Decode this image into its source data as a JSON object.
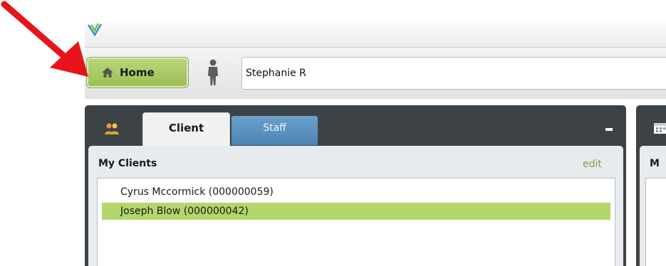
{
  "nav": {
    "home_label": "Home",
    "home_icon": "house-icon",
    "user_icon": "person-icon",
    "current_user": "Stephanie R"
  },
  "panel": {
    "tabs": [
      {
        "label": "Client",
        "active": true
      },
      {
        "label": "Staff",
        "active": false
      }
    ],
    "collapse_label": "-",
    "section_title": "My Clients",
    "edit_label": "edit",
    "clients": [
      {
        "label": "Cyrus Mccormick (000000059)",
        "selected": false
      },
      {
        "label": "Joseph Blow (000000042)",
        "selected": true
      }
    ]
  },
  "second_panel": {
    "section_title_partial": "M"
  },
  "colors": {
    "home_button": "#a7c660",
    "selected_row": "#b2d66a",
    "panel_dark": "#3d4246",
    "staff_tab": "#5a90c0",
    "annotation_arrow": "#e8141b",
    "edit_link": "#7aa23a"
  }
}
